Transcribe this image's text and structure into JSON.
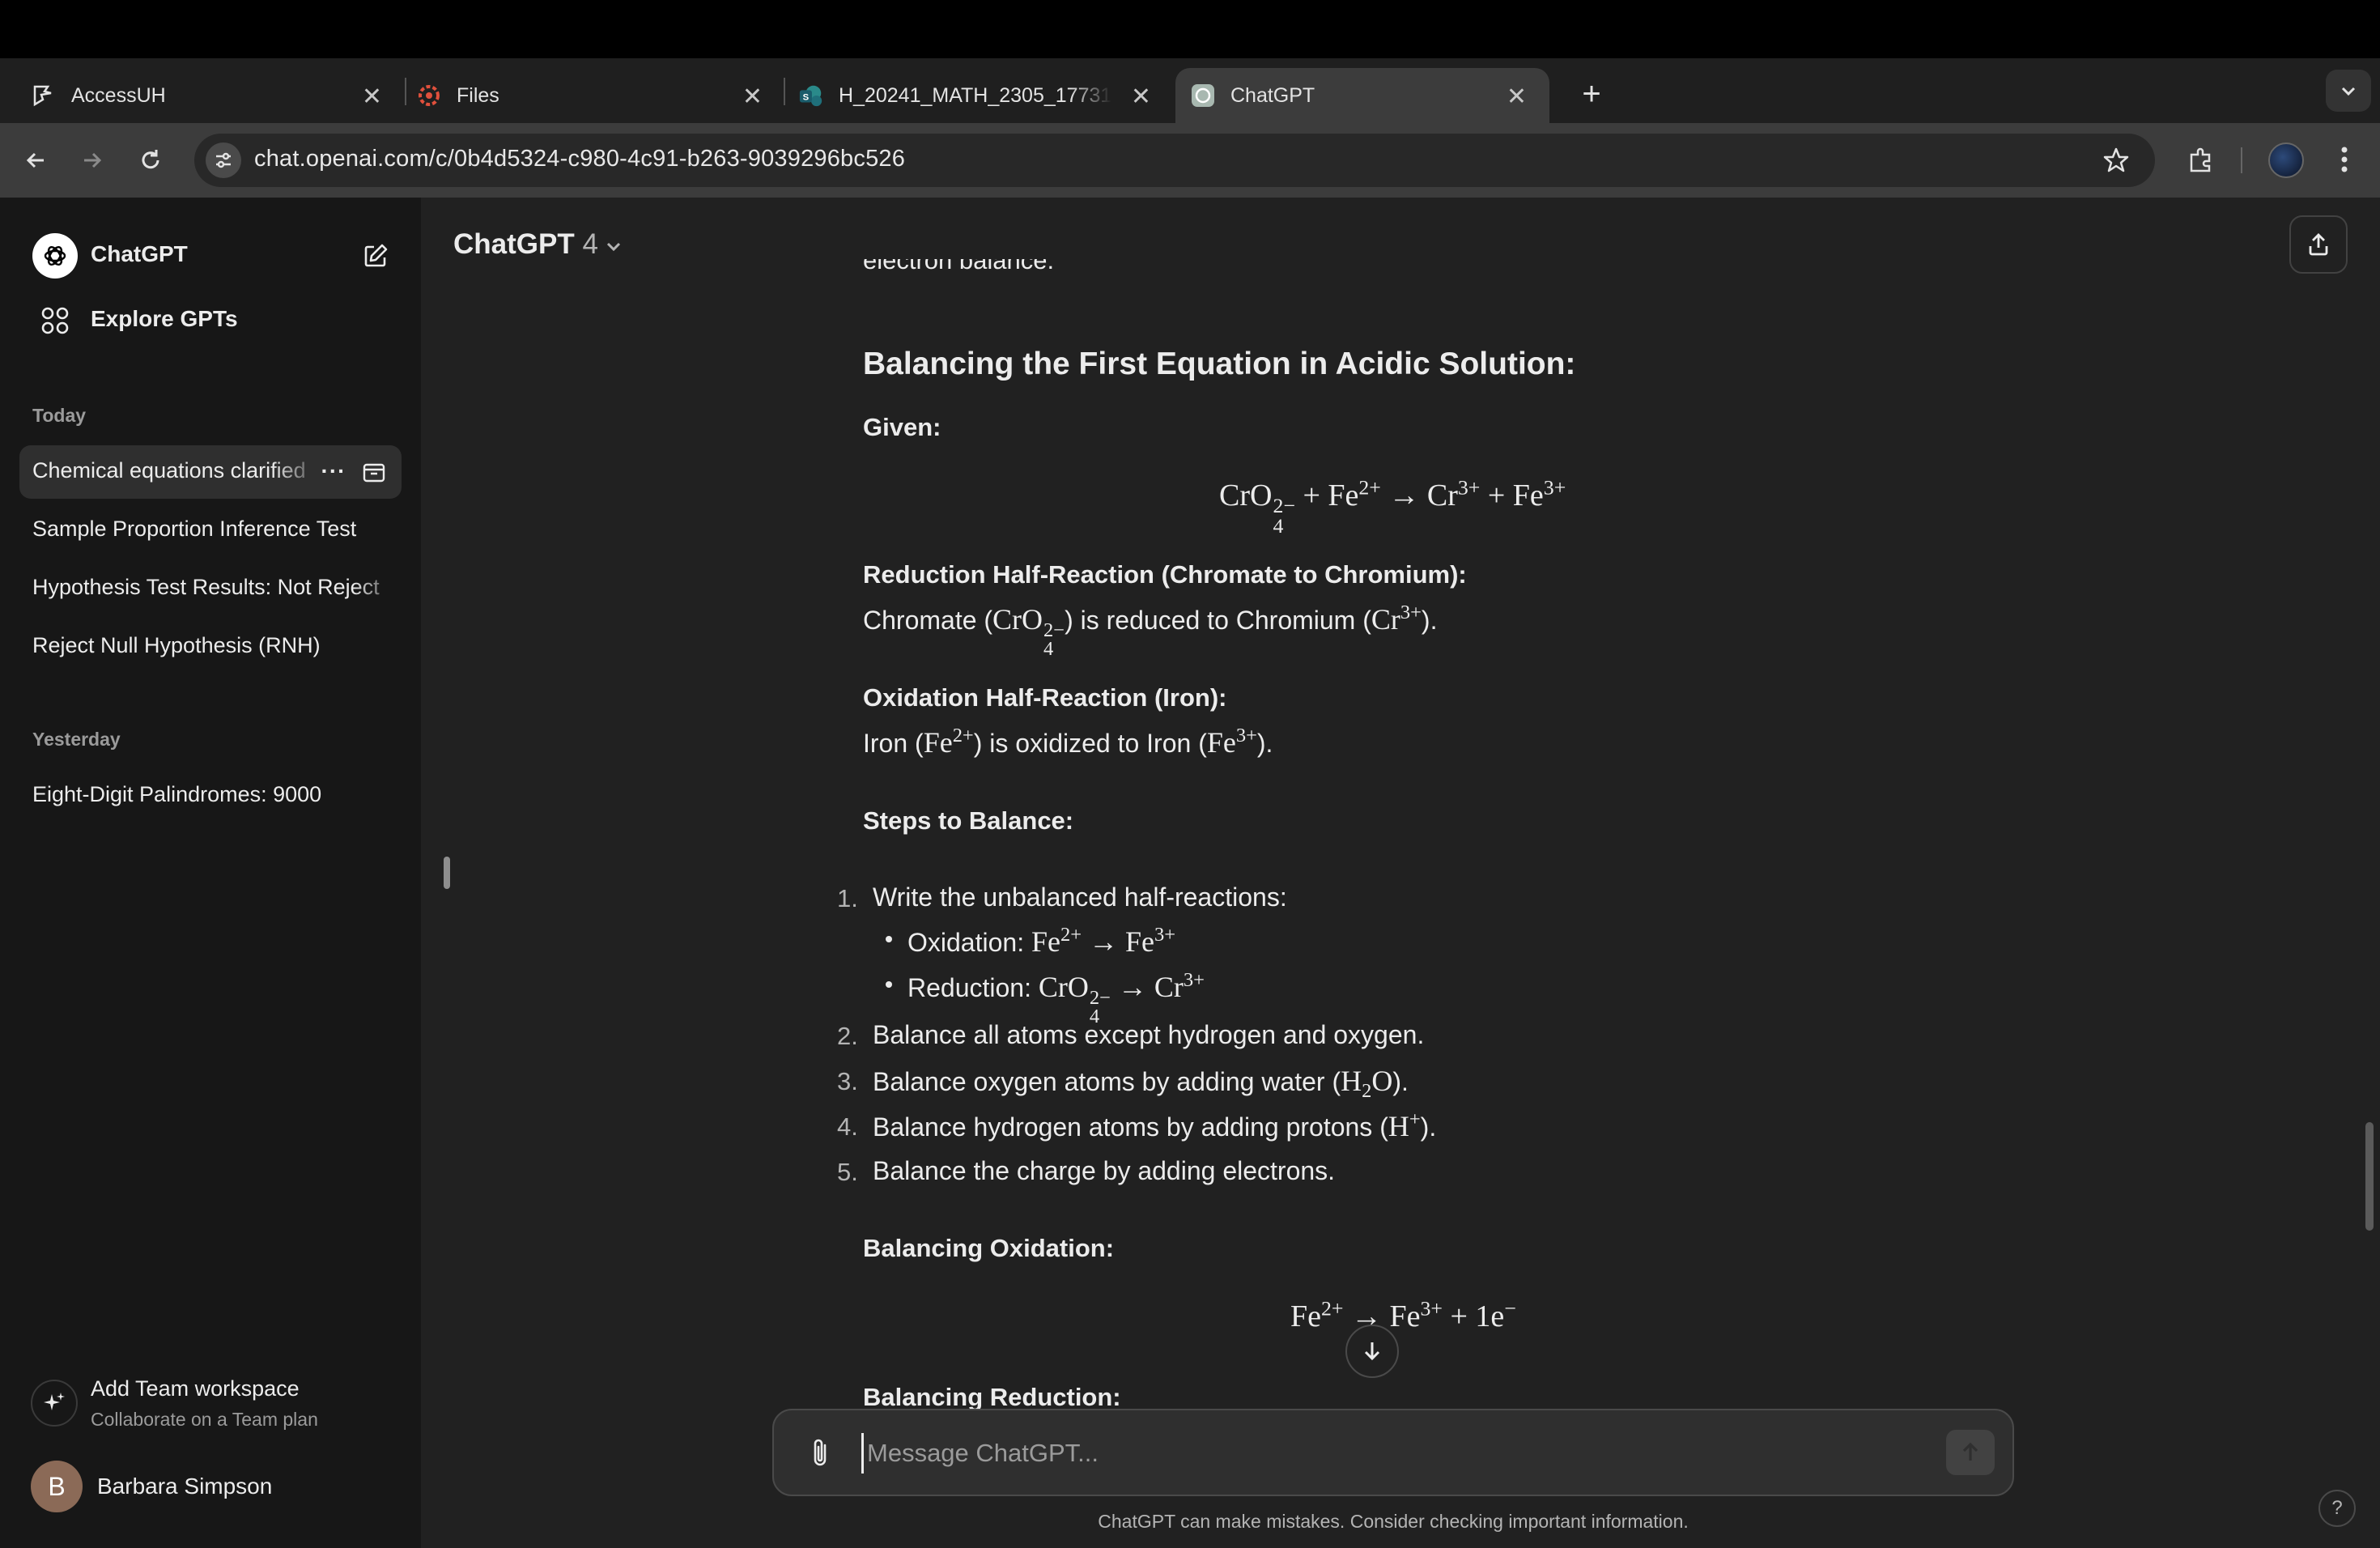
{
  "browser": {
    "tabs": [
      {
        "label": "AccessUH",
        "icon": "accessuh-icon"
      },
      {
        "label": "Files",
        "icon": "files-icon"
      },
      {
        "label": "H_20241_MATH_2305_17731",
        "icon": "sharepoint-icon"
      },
      {
        "label": "ChatGPT",
        "icon": "chatgpt-icon",
        "active": true
      }
    ],
    "url": "chat.openai.com/c/0b4d5324-c980-4c91-b263-9039296bc526"
  },
  "sidebar": {
    "title": "ChatGPT",
    "explore": "Explore GPTs",
    "today_label": "Today",
    "today": [
      "Chemical equations clarified",
      "Sample Proportion Inference Test",
      "Hypothesis Test Results: Not Reject",
      "Reject Null Hypothesis (RNH)"
    ],
    "yesterday_label": "Yesterday",
    "yesterday": [
      "Eight-Digit Palindromes: 9000"
    ],
    "team_title": "Add Team workspace",
    "team_sub": "Collaborate on a Team plan",
    "user_initial": "B",
    "user_name": "Barbara Simpson"
  },
  "header": {
    "model": "ChatGPT",
    "version": "4"
  },
  "content": {
    "cut_text": "electron balance.",
    "heading": "Balancing the First Equation in Acidic Solution:",
    "given_label": "Given:",
    "reduction_label": "Reduction Half-Reaction (Chromate to Chromium):",
    "reduction_text_a": "Chromate (",
    "reduction_text_b": ") is reduced to Chromium (",
    "reduction_text_c": ").",
    "oxidation_label": "Oxidation Half-Reaction (Iron):",
    "oxidation_text_a": "Iron (",
    "oxidation_text_b": ") is oxidized to Iron (",
    "oxidation_text_c": ").",
    "steps_label": "Steps to Balance:",
    "steps": [
      "Write the unbalanced half-reactions:",
      "Balance all atoms except hydrogen and oxygen.",
      "Balance oxygen atoms by adding water (",
      "Balance hydrogen atoms by adding protons (",
      "Balance the charge by adding electrons."
    ],
    "step_nums": [
      "1.",
      "2.",
      "3.",
      "4.",
      "5."
    ],
    "sub_oxidation": "Oxidation: ",
    "sub_reduction": "Reduction: ",
    "balancing_oxidation": "Balancing Oxidation:",
    "balancing_reduction": "Balancing Reduction:"
  },
  "composer": {
    "placeholder": "Message ChatGPT...",
    "disclaimer": "ChatGPT can make mistakes. Consider checking important information."
  },
  "help": "?"
}
